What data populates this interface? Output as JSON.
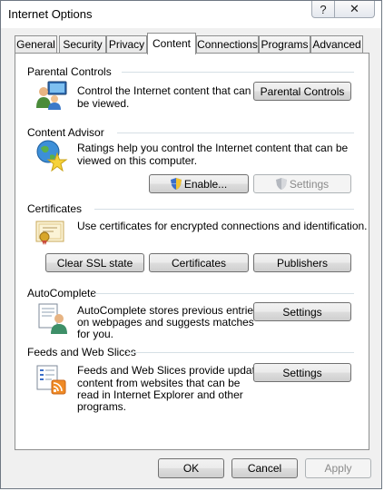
{
  "window": {
    "title": "Internet Options",
    "help_glyph": "?",
    "close_glyph": "✕"
  },
  "tabs": [
    {
      "label": "General"
    },
    {
      "label": "Security"
    },
    {
      "label": "Privacy"
    },
    {
      "label": "Content",
      "selected": true
    },
    {
      "label": "Connections"
    },
    {
      "label": "Programs"
    },
    {
      "label": "Advanced"
    }
  ],
  "parental_controls": {
    "title": "Parental Controls",
    "description_1": "Control the Internet content that can",
    "description_2": "be viewed.",
    "button": "Parental Controls",
    "icon": "parental-controls-icon"
  },
  "content_advisor": {
    "title": "Content Advisor",
    "description_1": "Ratings help you control the Internet content that can be",
    "description_2": "viewed on this computer.",
    "enable_button": "Enable...",
    "settings_button": "Settings",
    "icon": "globe-star-icon"
  },
  "certificates": {
    "title": "Certificates",
    "description": "Use certificates for encrypted connections and identification.",
    "clear_ssl_button": "Clear SSL state",
    "certificates_button": "Certificates",
    "publishers_button": "Publishers",
    "icon": "certificate-icon"
  },
  "autocomplete": {
    "title": "AutoComplete",
    "description_1": "AutoComplete stores previous entries",
    "description_2": "on webpages and suggests matches",
    "description_3": "for you.",
    "button": "Settings",
    "icon": "autocomplete-icon"
  },
  "feeds": {
    "title": "Feeds and Web Slices",
    "description_1": "Feeds and Web Slices provide updated",
    "description_2": "content from websites that can be",
    "description_3": "read in Internet Explorer and other",
    "description_4": "programs.",
    "button": "Settings",
    "icon": "rss-feed-icon"
  },
  "footer": {
    "ok": "OK",
    "cancel": "Cancel",
    "apply": "Apply"
  },
  "colors": {
    "accent": "#3c7fb1",
    "panel_border": "#8e8f8f",
    "disabled_text": "#8a8a8a"
  }
}
